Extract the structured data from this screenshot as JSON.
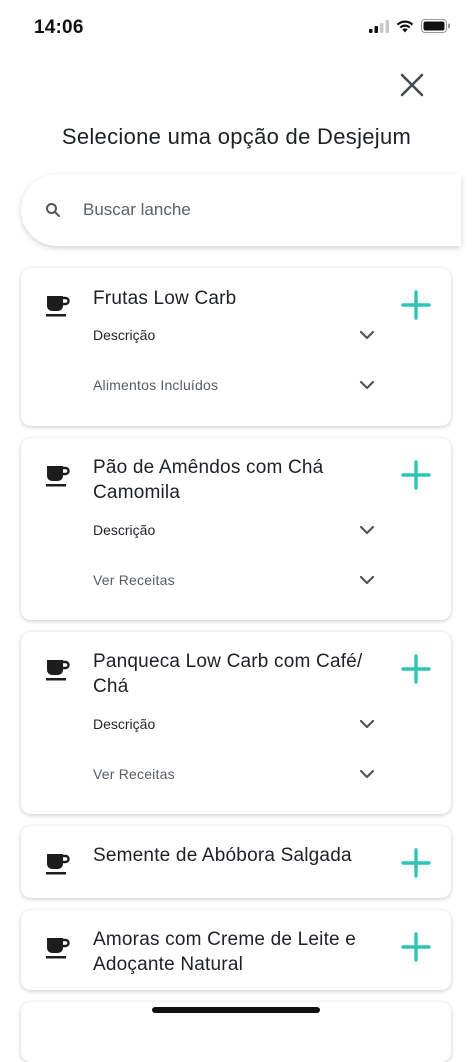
{
  "status": {
    "time": "14:06"
  },
  "page": {
    "title": "Selecione uma opção de Desjejum"
  },
  "search": {
    "placeholder": "Buscar lanche"
  },
  "colors": {
    "accent": "#2ec4b6",
    "text": "#1d2126",
    "muted": "#555c63"
  },
  "cards": [
    {
      "title": "Frutas Low Carb",
      "rows": [
        "Descrição",
        "Alimentos Incluídos"
      ]
    },
    {
      "title": "Pão de Amêndos com Chá Camomila",
      "rows": [
        "Descrição",
        "Ver Receitas"
      ]
    },
    {
      "title": "Panqueca Low Carb com Café/ Chá",
      "rows": [
        "Descrição",
        "Ver Receitas"
      ]
    },
    {
      "title": "Semente de Abóbora Salgada",
      "rows": []
    },
    {
      "title": "Amoras com Creme de Leite e Adoçante Natural",
      "rows": []
    }
  ],
  "icons": {
    "card": "coffee-cup-icon",
    "add": "plus-icon",
    "expand": "chevron-down-icon"
  }
}
